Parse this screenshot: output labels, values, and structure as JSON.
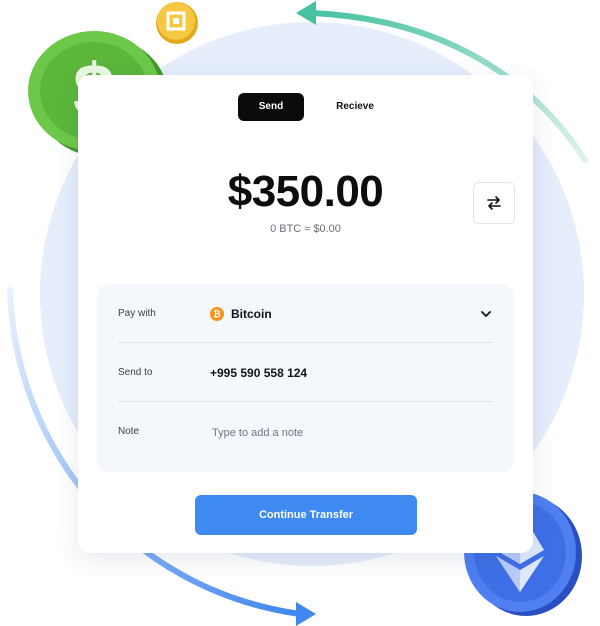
{
  "tabs": {
    "send_label": "Send",
    "receive_label": "Recieve"
  },
  "amount": "$350.00",
  "conversion": "0 BTC ≈ $0.00",
  "form": {
    "pay_with": {
      "label": "Pay with",
      "value": "Bitcoin",
      "icon": "bitcoin-icon"
    },
    "send_to": {
      "label": "Send to",
      "value": "+995 590 558 124"
    },
    "note": {
      "label": "Note",
      "placeholder": "Type to add a note"
    }
  },
  "button": {
    "continue_label": "Continue Transfer"
  },
  "colors": {
    "accent": "#3f8af0",
    "dark": "#0b0b0c",
    "bitcoin": "#f7931a",
    "dollar_coin": "#5cb93b",
    "eth_coin": "#3d6de8",
    "gold_coin": "#f3c33a"
  },
  "icons": [
    "swap-icon",
    "chevron-down-icon",
    "bitcoin-icon",
    "dollar-coin-icon",
    "ethereum-coin-icon",
    "binance-coin-icon"
  ]
}
